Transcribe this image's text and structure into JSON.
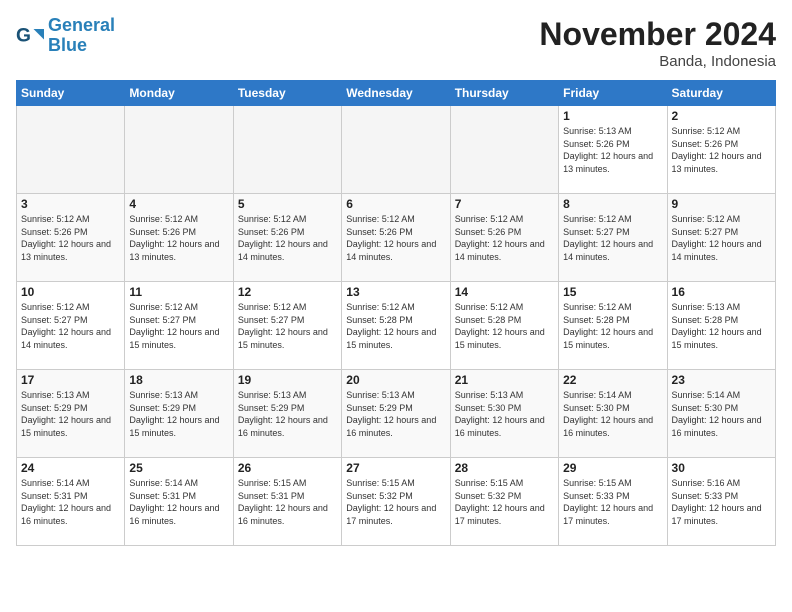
{
  "logo": {
    "text_general": "General",
    "text_blue": "Blue"
  },
  "title": "November 2024",
  "location": "Banda, Indonesia",
  "weekdays": [
    "Sunday",
    "Monday",
    "Tuesday",
    "Wednesday",
    "Thursday",
    "Friday",
    "Saturday"
  ],
  "weeks": [
    [
      {
        "day": "",
        "empty": true
      },
      {
        "day": "",
        "empty": true
      },
      {
        "day": "",
        "empty": true
      },
      {
        "day": "",
        "empty": true
      },
      {
        "day": "",
        "empty": true
      },
      {
        "day": "1",
        "sunrise": "5:13 AM",
        "sunset": "5:26 PM",
        "daylight": "12 hours and 13 minutes."
      },
      {
        "day": "2",
        "sunrise": "5:12 AM",
        "sunset": "5:26 PM",
        "daylight": "12 hours and 13 minutes."
      }
    ],
    [
      {
        "day": "3",
        "sunrise": "5:12 AM",
        "sunset": "5:26 PM",
        "daylight": "12 hours and 13 minutes."
      },
      {
        "day": "4",
        "sunrise": "5:12 AM",
        "sunset": "5:26 PM",
        "daylight": "12 hours and 13 minutes."
      },
      {
        "day": "5",
        "sunrise": "5:12 AM",
        "sunset": "5:26 PM",
        "daylight": "12 hours and 14 minutes."
      },
      {
        "day": "6",
        "sunrise": "5:12 AM",
        "sunset": "5:26 PM",
        "daylight": "12 hours and 14 minutes."
      },
      {
        "day": "7",
        "sunrise": "5:12 AM",
        "sunset": "5:26 PM",
        "daylight": "12 hours and 14 minutes."
      },
      {
        "day": "8",
        "sunrise": "5:12 AM",
        "sunset": "5:27 PM",
        "daylight": "12 hours and 14 minutes."
      },
      {
        "day": "9",
        "sunrise": "5:12 AM",
        "sunset": "5:27 PM",
        "daylight": "12 hours and 14 minutes."
      }
    ],
    [
      {
        "day": "10",
        "sunrise": "5:12 AM",
        "sunset": "5:27 PM",
        "daylight": "12 hours and 14 minutes."
      },
      {
        "day": "11",
        "sunrise": "5:12 AM",
        "sunset": "5:27 PM",
        "daylight": "12 hours and 15 minutes."
      },
      {
        "day": "12",
        "sunrise": "5:12 AM",
        "sunset": "5:27 PM",
        "daylight": "12 hours and 15 minutes."
      },
      {
        "day": "13",
        "sunrise": "5:12 AM",
        "sunset": "5:28 PM",
        "daylight": "12 hours and 15 minutes."
      },
      {
        "day": "14",
        "sunrise": "5:12 AM",
        "sunset": "5:28 PM",
        "daylight": "12 hours and 15 minutes."
      },
      {
        "day": "15",
        "sunrise": "5:12 AM",
        "sunset": "5:28 PM",
        "daylight": "12 hours and 15 minutes."
      },
      {
        "day": "16",
        "sunrise": "5:13 AM",
        "sunset": "5:28 PM",
        "daylight": "12 hours and 15 minutes."
      }
    ],
    [
      {
        "day": "17",
        "sunrise": "5:13 AM",
        "sunset": "5:29 PM",
        "daylight": "12 hours and 15 minutes."
      },
      {
        "day": "18",
        "sunrise": "5:13 AM",
        "sunset": "5:29 PM",
        "daylight": "12 hours and 15 minutes."
      },
      {
        "day": "19",
        "sunrise": "5:13 AM",
        "sunset": "5:29 PM",
        "daylight": "12 hours and 16 minutes."
      },
      {
        "day": "20",
        "sunrise": "5:13 AM",
        "sunset": "5:29 PM",
        "daylight": "12 hours and 16 minutes."
      },
      {
        "day": "21",
        "sunrise": "5:13 AM",
        "sunset": "5:30 PM",
        "daylight": "12 hours and 16 minutes."
      },
      {
        "day": "22",
        "sunrise": "5:14 AM",
        "sunset": "5:30 PM",
        "daylight": "12 hours and 16 minutes."
      },
      {
        "day": "23",
        "sunrise": "5:14 AM",
        "sunset": "5:30 PM",
        "daylight": "12 hours and 16 minutes."
      }
    ],
    [
      {
        "day": "24",
        "sunrise": "5:14 AM",
        "sunset": "5:31 PM",
        "daylight": "12 hours and 16 minutes."
      },
      {
        "day": "25",
        "sunrise": "5:14 AM",
        "sunset": "5:31 PM",
        "daylight": "12 hours and 16 minutes."
      },
      {
        "day": "26",
        "sunrise": "5:15 AM",
        "sunset": "5:31 PM",
        "daylight": "12 hours and 16 minutes."
      },
      {
        "day": "27",
        "sunrise": "5:15 AM",
        "sunset": "5:32 PM",
        "daylight": "12 hours and 17 minutes."
      },
      {
        "day": "28",
        "sunrise": "5:15 AM",
        "sunset": "5:32 PM",
        "daylight": "12 hours and 17 minutes."
      },
      {
        "day": "29",
        "sunrise": "5:15 AM",
        "sunset": "5:33 PM",
        "daylight": "12 hours and 17 minutes."
      },
      {
        "day": "30",
        "sunrise": "5:16 AM",
        "sunset": "5:33 PM",
        "daylight": "12 hours and 17 minutes."
      }
    ]
  ],
  "labels": {
    "sunrise": "Sunrise:",
    "sunset": "Sunset:",
    "daylight": "Daylight:"
  }
}
